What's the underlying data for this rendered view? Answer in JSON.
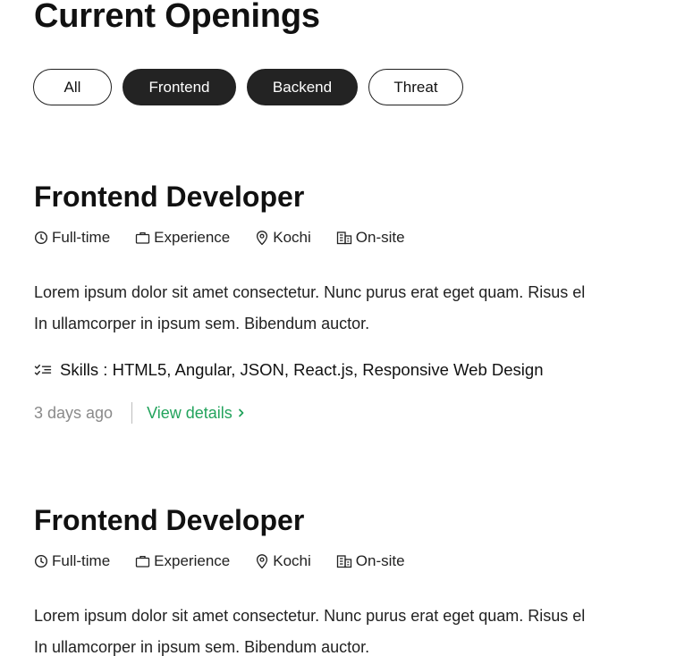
{
  "heading": "Current Openings",
  "filters": [
    {
      "label": "All",
      "active": false
    },
    {
      "label": "Frontend",
      "active": true
    },
    {
      "label": "Backend",
      "active": true
    },
    {
      "label": "Threat",
      "active": false
    }
  ],
  "jobs": [
    {
      "title": "Frontend Developer",
      "meta": {
        "type": "Full-time",
        "level": "Experience",
        "location": "Kochi",
        "mode": "On-site"
      },
      "description_line1": "Lorem ipsum dolor sit amet consectetur. Nunc purus erat eget quam. Risus el",
      "description_line2": "In ullamcorper in ipsum sem. Bibendum auctor.",
      "skills": "Skills : HTML5, Angular, JSON, React.js, Responsive Web Design",
      "posted": "3 days ago",
      "link_label": "View details"
    },
    {
      "title": "Frontend Developer",
      "meta": {
        "type": "Full-time",
        "level": "Experience",
        "location": "Kochi",
        "mode": "On-site"
      },
      "description_line1": "Lorem ipsum dolor sit amet consectetur. Nunc purus erat eget quam. Risus el",
      "description_line2": "In ullamcorper in ipsum sem. Bibendum auctor."
    }
  ],
  "icons": {
    "type": "clock-icon",
    "level": "briefcase-icon",
    "location": "map-pin-icon",
    "mode": "building-icon",
    "skills": "checklist-icon",
    "link": "chevron-right-icon"
  },
  "colors": {
    "active_pill": "#232323",
    "link": "#22a35c",
    "muted": "#8a8a8a"
  }
}
